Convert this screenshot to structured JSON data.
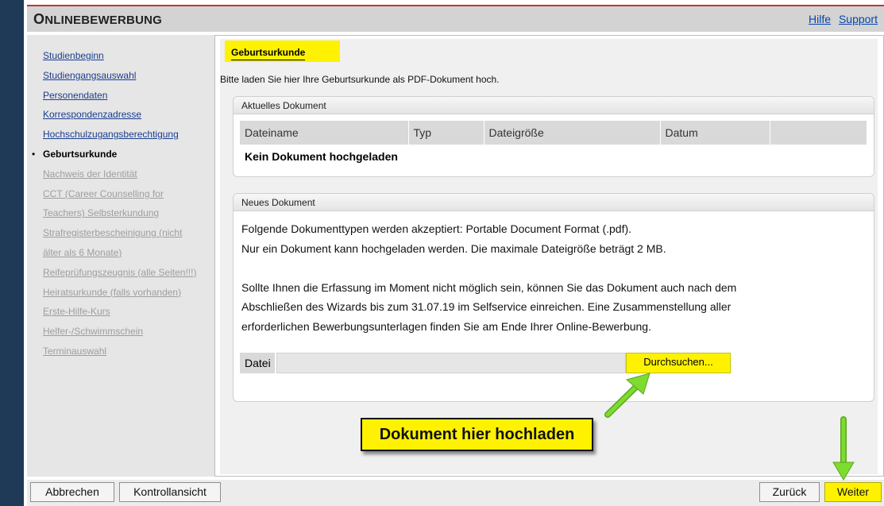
{
  "header": {
    "title_first": "O",
    "title_rest": "NLINEBEWERBUNG",
    "help_link": "Hilfe",
    "support_link": "Support"
  },
  "sidebar": {
    "items": [
      {
        "label": "Studienbeginn",
        "state": "link"
      },
      {
        "label": "Studiengangsauswahl",
        "state": "link"
      },
      {
        "label": "Personendaten",
        "state": "link"
      },
      {
        "label": "Korrespondenzadresse",
        "state": "link"
      },
      {
        "label": "Hochschulzugangsberechtigung",
        "state": "link"
      },
      {
        "label": "Geburtsurkunde",
        "state": "active"
      },
      {
        "label": "Nachweis der Identität",
        "state": "disabled"
      },
      {
        "label": "CCT (Career Counselling for",
        "state": "disabled"
      },
      {
        "label": "Teachers) Selbsterkundung",
        "state": "disabled"
      },
      {
        "label": "Strafregisterbescheinigung (nicht",
        "state": "disabled"
      },
      {
        "label": "älter als 6 Monate)",
        "state": "disabled"
      },
      {
        "label": "Reifeprüfungszeugnis (alle Seiten!!!)",
        "state": "disabled"
      },
      {
        "label": "Heiratsurkunde (falls vorhanden)",
        "state": "disabled"
      },
      {
        "label": "Erste-Hilfe-Kurs",
        "state": "disabled"
      },
      {
        "label": "Helfer-/Schwimmschein",
        "state": "disabled"
      },
      {
        "label": "Terminauswahl",
        "state": "disabled"
      }
    ]
  },
  "main": {
    "tab_label": "Geburtsurkunde",
    "intro": "Bitte laden Sie hier Ihre Geburtsurkunde als PDF-Dokument hoch.",
    "current_doc": {
      "heading": "Aktuelles Dokument",
      "columns": [
        "Dateiname",
        "Typ",
        "Dateigröße",
        "Datum",
        ""
      ],
      "empty_text": "Kein Dokument hochgeladen"
    },
    "new_doc": {
      "heading": "Neues Dokument",
      "line1": "Folgende Dokumenttypen werden akzeptiert: Portable Document Format (.pdf).",
      "line2": "Nur ein Dokument kann hochgeladen werden. Die maximale Dateigröße beträgt 2 MB.",
      "line3": "Sollte Ihnen die Erfassung im Moment nicht möglich sein, können Sie das Dokument auch nach dem",
      "line4": "Abschließen des Wizards bis zum 31.07.19 im Selfservice einreichen. Eine Zusammenstellung aller",
      "line5": "erforderlichen Bewerbungsunterlagen finden Sie am Ende Ihrer Online-Bewerbung.",
      "file_label": "Datei",
      "browse_label": "Durchsuchen..."
    }
  },
  "annotation": {
    "callout_text": "Dokument hier hochladen"
  },
  "footer": {
    "cancel_label": "Abbrechen",
    "control_label": "Kontrollansicht",
    "back_label": "Zurück",
    "next_label": "Weiter"
  },
  "colors": {
    "highlight": "#fff200",
    "arrow": "#7ddc2e",
    "background": "#1f3a57"
  }
}
